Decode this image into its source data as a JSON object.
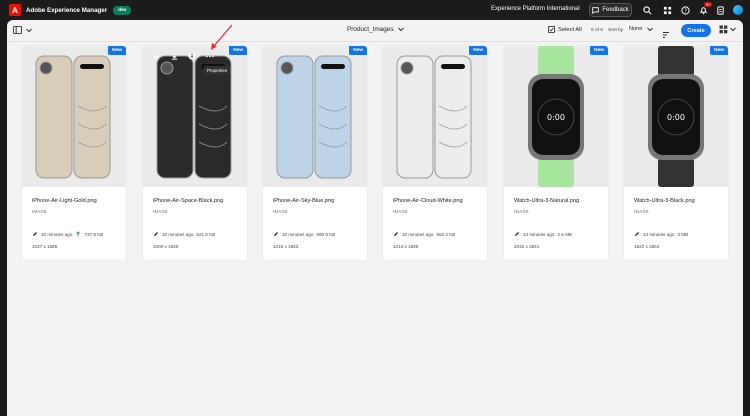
{
  "topbar": {
    "logo_glyph": "A",
    "app_name": "Adobe Experience Manager",
    "env_badge": "dev",
    "org_name": "Experience Platform International",
    "feedback_label": "Feedback",
    "notification_count": "9+",
    "icons": [
      "feedback-icon",
      "search-icon",
      "apps-grid-icon",
      "help-icon",
      "bell-icon",
      "user-avatar"
    ]
  },
  "toolbar": {
    "folder_name": "Product_Images",
    "select_all_label": "Select All",
    "item_count": "6 of 6",
    "sort_by_label": "Sort by",
    "sort_by_value": "None",
    "create_label": "Create"
  },
  "hover_tooltip": "Properties",
  "colors": {
    "accent": "#1473e6",
    "env_badge": "#0d7d5d",
    "logo": "#eb1000",
    "arrow": "#e8261c"
  },
  "cards": [
    {
      "name": "iPhone-Air-Light-Gold.png",
      "type": "IMAGE",
      "modified": "10 minutes ago",
      "size": "737.9 KB",
      "dims": "1027 x 1695",
      "badge": "New",
      "color": "#d8cdb8",
      "kind": "phone"
    },
    {
      "name": "iPhone-Air-Space-Black.png",
      "type": "IMAGE",
      "modified": "10 minutes ago",
      "size": "621.5 KB",
      "dims": "1000 x 1659",
      "badge": "New",
      "color": "#2a2a2a",
      "kind": "phone"
    },
    {
      "name": "iPhone-Air-Sky-Blue.png",
      "type": "IMAGE",
      "modified": "10 minutes ago",
      "size": "890.9 KB",
      "dims": "1015 x 1663",
      "badge": "New",
      "color": "#bcd3e8",
      "kind": "phone"
    },
    {
      "name": "iPhone-Air-Cloud-White.png",
      "type": "IMAGE",
      "modified": "10 minutes ago",
      "size": "552.2 KB",
      "dims": "1014 x 1686",
      "badge": "New",
      "color": "#ececec",
      "kind": "phone"
    },
    {
      "name": "Watch-Ultra-3-Natural.png",
      "type": "IMAGE",
      "modified": "13 minutes ago",
      "size": "2.6 MB",
      "dims": "2032 x 2841",
      "badge": "New",
      "color": "#a8e6a0",
      "kind": "watch"
    },
    {
      "name": "Watch-Ultra-3-Black.png",
      "type": "IMAGE",
      "modified": "13 minutes ago",
      "size": "3 MB",
      "dims": "1822 x 2852",
      "badge": "New",
      "color": "#333333",
      "kind": "watch"
    }
  ]
}
